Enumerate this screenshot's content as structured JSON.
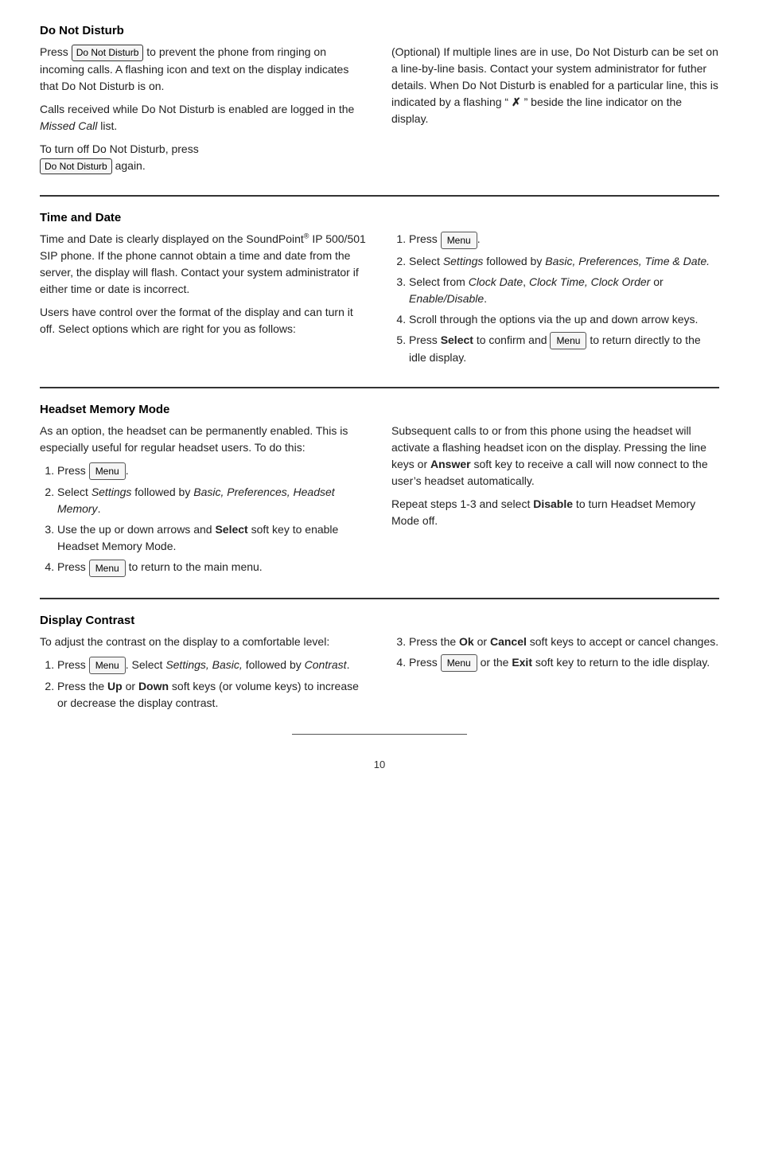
{
  "sections": [
    {
      "id": "do-not-disturb",
      "title": "Do Not Disturb",
      "left": {
        "paragraphs": [
          {
            "type": "mixed",
            "parts": [
              {
                "text": "Press ",
                "style": "normal"
              },
              {
                "text": "Do Not Disturb",
                "style": "btn"
              },
              {
                "text": " to prevent the phone from ringing on incoming calls.  A flashing icon and text on the display indicates that Do Not Disturb is on.",
                "style": "normal"
              }
            ]
          },
          {
            "type": "plain",
            "text": "Calls received while Do Not Disturb is enabled are logged in the Missed Call list.",
            "italic_word": "Missed Call"
          },
          {
            "type": "turnoff",
            "text": "To turn off Do Not Disturb, press",
            "btn": "Do Not Disturb",
            "after": " again."
          }
        ]
      },
      "right": {
        "text": "(Optional) If multiple lines are in use, Do Not Disturb can be set on a line-by-line basis.  Contact your system administrator for futher details.  When Do Not Disturb is enabled for a particular line, this is indicated by a flashing “ ✗ ” beside the line indicator on the display."
      }
    },
    {
      "id": "time-and-date",
      "title": "Time and Date",
      "left": {
        "paragraphs": [
          "Time and Date is clearly displayed on the SoundPoint® IP 500/501 SIP phone.  If the phone cannot obtain a time and date from the server, the display will flash.  Contact your system administrator if either time or date is incorrect.",
          "Users have control over the format of the display and can turn it off.  Select options which are right for you as follows:"
        ]
      },
      "right": {
        "steps": [
          {
            "num": 1,
            "type": "press_menu",
            "text": "Press ",
            "after": "."
          },
          {
            "num": 2,
            "type": "italic_mixed",
            "text": "Select Settings followed by Basic, Preferences, Time & Date."
          },
          {
            "num": 3,
            "type": "italic_mixed",
            "text": "Select from Clock Date, Clock Time, Clock Order or Enable/Disable."
          },
          {
            "num": 4,
            "type": "plain",
            "text": "Scroll through the options via the up and down arrow keys."
          },
          {
            "num": 5,
            "type": "select_menu",
            "text": "Press Select to confirm and ",
            "menu_after": " to return directly to the idle display."
          }
        ]
      }
    },
    {
      "id": "headset-memory-mode",
      "title": "Headset Memory Mode",
      "left": {
        "intro": "As an option, the headset can be permanently enabled.  This is especially useful for regular headset users.  To do this:",
        "steps": [
          {
            "num": 1,
            "type": "press_menu",
            "text": "Press ",
            "after": "."
          },
          {
            "num": 2,
            "type": "italic_mixed",
            "text": "Select Settings followed by Basic, Preferences, Headset Memory."
          },
          {
            "num": 3,
            "type": "select_bold",
            "text": "Use the up or down arrows and Select soft key to enable Headset Memory Mode."
          },
          {
            "num": 4,
            "type": "press_menu_text",
            "text": "Press ",
            "after": " to return to the main menu."
          }
        ]
      },
      "right": {
        "paragraphs": [
          "Subsequent calls to or from this phone using the headset will activate a flashing headset icon on the display.  Pressing the line keys or Answer soft key to receive a call will now connect to the user’s headset automatically.",
          "Repeat steps 1-3 and select Disable to turn Headset Memory Mode off."
        ]
      }
    },
    {
      "id": "display-contrast",
      "title": "Display Contrast",
      "left": {
        "intro": "To adjust the contrast on the display to a comfortable level:",
        "steps": [
          {
            "num": 1,
            "type": "press_menu_select",
            "text": "Press ",
            "select_text": "Select Settings, Basic, followed by Contrast.",
            "after": "."
          },
          {
            "num": 2,
            "type": "bold_mixed",
            "text": "Press the Up or Down soft keys (or volume keys) to increase or decrease the display contrast."
          }
        ]
      },
      "right": {
        "steps": [
          {
            "num": 3,
            "type": "bold_mixed",
            "text": "Press the Ok or Cancel soft keys to accept or cancel changes."
          },
          {
            "num": 4,
            "type": "press_menu_exit",
            "text": "Press ",
            "after": " or the Exit soft key to return to the idle display."
          }
        ]
      }
    }
  ],
  "page_number": "10",
  "labels": {
    "do_not_disturb_btn": "Do Not Disturb",
    "menu_btn": "Menu"
  }
}
